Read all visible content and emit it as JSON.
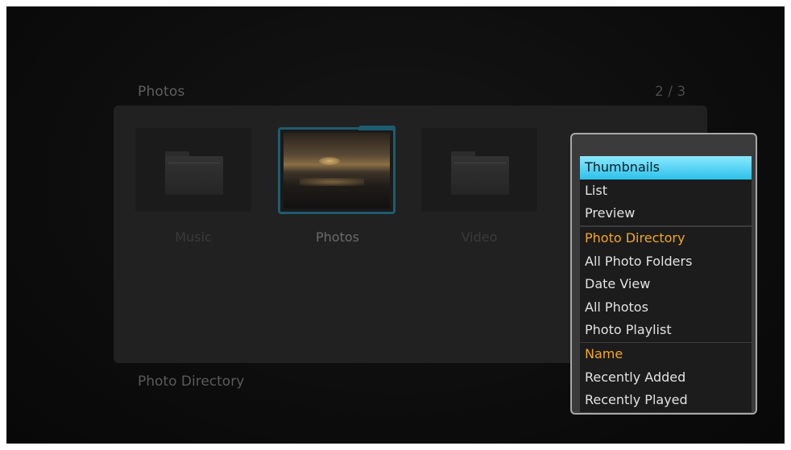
{
  "header": {
    "title": "Photos",
    "page_counter": "2 / 3"
  },
  "tiles": [
    {
      "label": "Music",
      "icon": "folder-icon"
    },
    {
      "label": "Photos",
      "icon": "photo-thumbnail",
      "selected": true
    },
    {
      "label": "Video",
      "icon": "folder-icon"
    }
  ],
  "footer": {
    "label": "Photo Directory"
  },
  "menu": {
    "view_group": [
      "Thumbnails",
      "List",
      "Preview"
    ],
    "filter_group": [
      "Photo Directory",
      "All Photo Folders",
      "Date View",
      "All Photos",
      "Photo Playlist"
    ],
    "sort_group": [
      "Name",
      "Recently Added",
      "Recently Played"
    ],
    "highlighted": "Thumbnails",
    "current_filter": "Photo Directory",
    "current_sort": "Name"
  },
  "colors": {
    "highlight": "#2cc1ea",
    "current_option": "#f2a628",
    "selection_border": "#1e5d6e"
  }
}
